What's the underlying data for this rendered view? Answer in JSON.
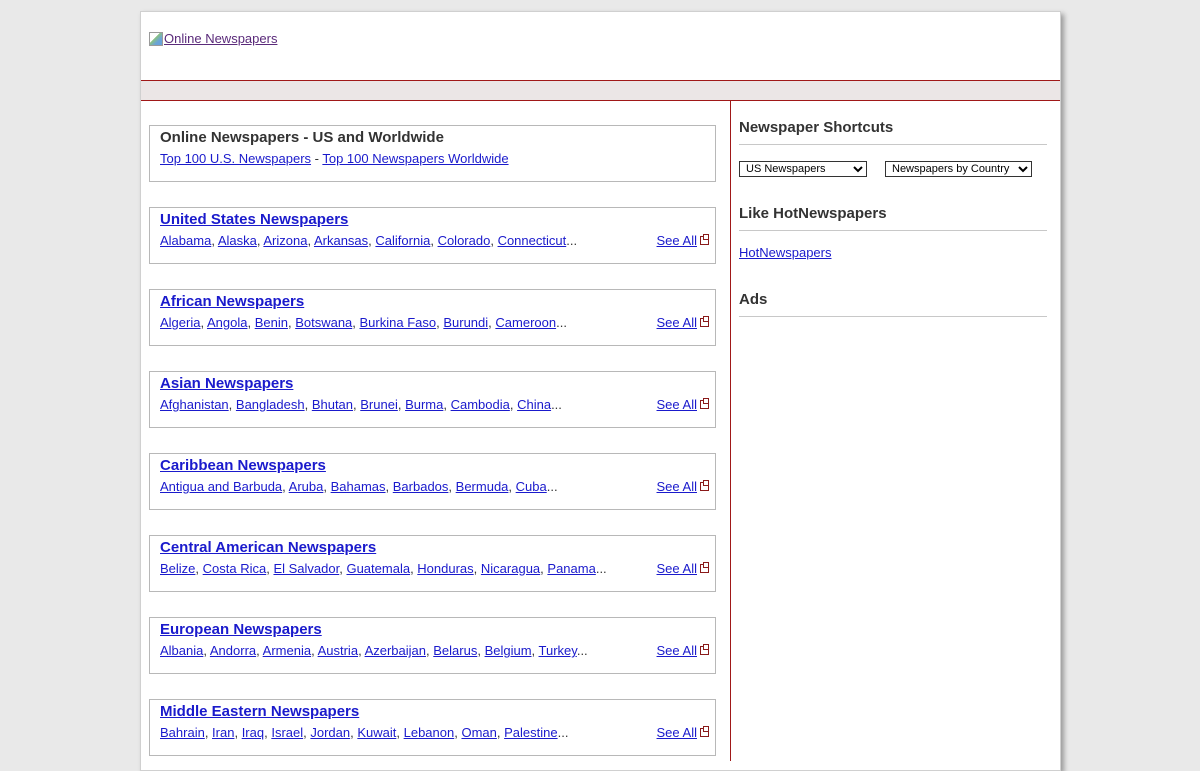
{
  "header": {
    "logo_alt": "Online Newspapers"
  },
  "intro": {
    "title": "Online Newspapers - US and Worldwide",
    "links": [
      "Top 100 U.S. Newspapers",
      "Top 100 Newspapers Worldwide"
    ],
    "separator": " - "
  },
  "see_all_label": "See All",
  "sections": [
    {
      "title": "United States Newspapers",
      "items": [
        "Alabama",
        "Alaska",
        "Arizona",
        "Arkansas",
        "California",
        "Colorado",
        "Connecticut"
      ]
    },
    {
      "title": "African Newspapers",
      "items": [
        "Algeria",
        "Angola",
        "Benin",
        "Botswana",
        "Burkina Faso",
        "Burundi",
        "Cameroon"
      ]
    },
    {
      "title": "Asian Newspapers",
      "items": [
        "Afghanistan",
        "Bangladesh",
        "Bhutan",
        "Brunei",
        "Burma",
        "Cambodia",
        "China"
      ]
    },
    {
      "title": "Caribbean Newspapers",
      "items": [
        "Antigua and Barbuda",
        "Aruba",
        "Bahamas",
        "Barbados",
        "Bermuda",
        "Cuba"
      ]
    },
    {
      "title": "Central American Newspapers",
      "items": [
        "Belize",
        "Costa Rica",
        "El Salvador",
        "Guatemala",
        "Honduras",
        "Nicaragua",
        "Panama"
      ]
    },
    {
      "title": "European Newspapers",
      "items": [
        "Albania",
        "Andorra",
        "Armenia",
        "Austria",
        "Azerbaijan",
        "Belarus",
        "Belgium",
        "Turkey"
      ]
    },
    {
      "title": "Middle Eastern Newspapers",
      "items": [
        "Bahrain",
        "Iran",
        "Iraq",
        "Israel",
        "Jordan",
        "Kuwait",
        "Lebanon",
        "Oman",
        "Palestine"
      ]
    }
  ],
  "sidebar": {
    "shortcuts_title": "Newspaper Shortcuts",
    "select_us": "US Newspapers",
    "select_country": "Newspapers by Country",
    "like_title": "Like HotNewspapers",
    "like_link": "HotNewspapers",
    "ads_title": "Ads"
  }
}
